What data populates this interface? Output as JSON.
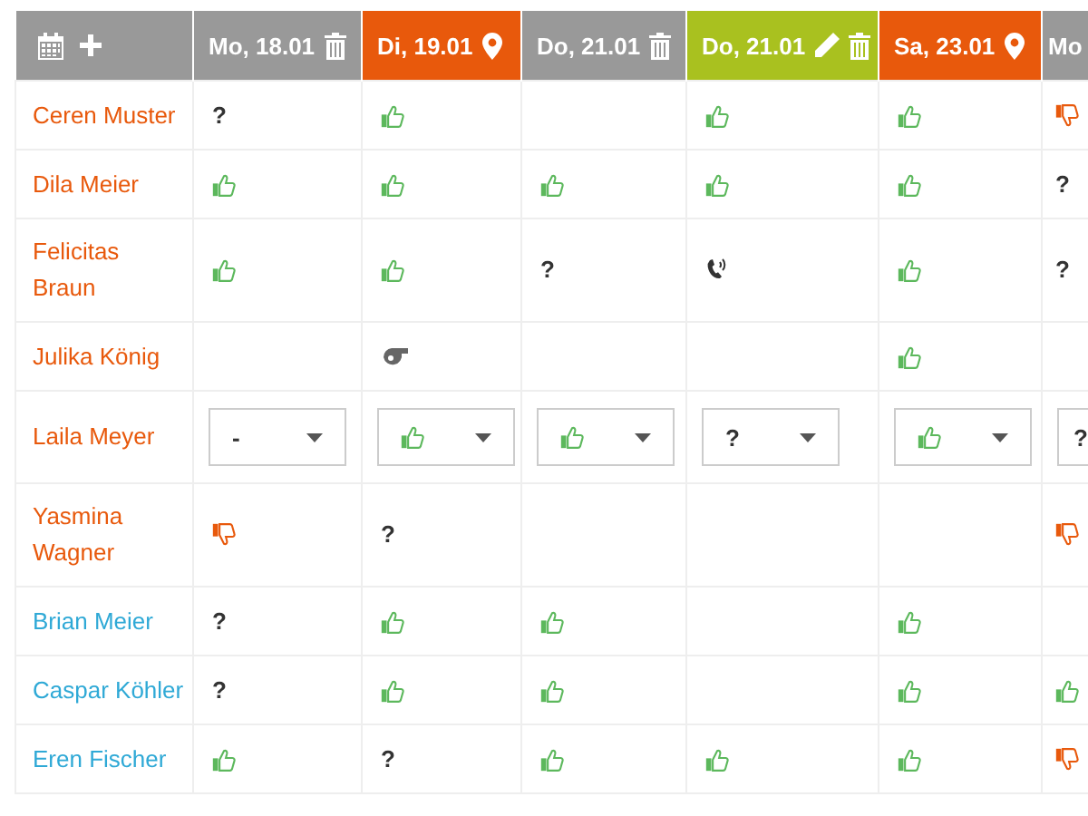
{
  "columns": [
    {
      "label": "Mo, 18.01",
      "color": "#999999",
      "editable": false,
      "deletable": true,
      "location": false
    },
    {
      "label": "Di, 19.01",
      "color": "#e8590c",
      "editable": false,
      "deletable": false,
      "location": true
    },
    {
      "label": "Do, 21.01",
      "color": "#999999",
      "editable": false,
      "deletable": true,
      "location": false
    },
    {
      "label": "Do, 21.01",
      "color": "#a9c11f",
      "editable": true,
      "deletable": true,
      "location": false
    },
    {
      "label": "Sa, 23.01",
      "color": "#e8590c",
      "editable": false,
      "deletable": false,
      "location": true
    },
    {
      "label": "Mo",
      "color": "#999999"
    }
  ],
  "rows": [
    {
      "name": "Ceren Muster",
      "color": "#e8590c",
      "cells": [
        {
          "kind": "maybe",
          "text": "?"
        },
        {
          "kind": "yes"
        },
        {
          "kind": "empty"
        },
        {
          "kind": "yes"
        },
        {
          "kind": "yes"
        },
        {
          "kind": "no"
        }
      ]
    },
    {
      "name": "Dila Meier",
      "color": "#e8590c",
      "cells": [
        {
          "kind": "yes"
        },
        {
          "kind": "yes"
        },
        {
          "kind": "yes"
        },
        {
          "kind": "yes"
        },
        {
          "kind": "yes"
        },
        {
          "kind": "maybe",
          "text": "?"
        }
      ]
    },
    {
      "name": "Felicitas Braun",
      "color": "#e8590c",
      "cells": [
        {
          "kind": "yes"
        },
        {
          "kind": "yes"
        },
        {
          "kind": "maybe",
          "text": "?"
        },
        {
          "kind": "phone"
        },
        {
          "kind": "yes"
        },
        {
          "kind": "maybe",
          "text": "?"
        }
      ]
    },
    {
      "name": "Julika König",
      "color": "#e8590c",
      "cells": [
        {
          "kind": "empty"
        },
        {
          "kind": "whistle"
        },
        {
          "kind": "empty"
        },
        {
          "kind": "empty"
        },
        {
          "kind": "yes"
        },
        {
          "kind": "empty"
        }
      ]
    },
    {
      "name": "Laila Meyer",
      "color": "#e8590c",
      "cells": [
        {
          "kind": "select",
          "text": "-"
        },
        {
          "kind": "select-yes"
        },
        {
          "kind": "select-yes"
        },
        {
          "kind": "select",
          "text": "?"
        },
        {
          "kind": "select-yes"
        },
        {
          "kind": "select",
          "text": "?"
        }
      ]
    },
    {
      "name": "Yasmina Wagner",
      "color": "#e8590c",
      "cells": [
        {
          "kind": "no"
        },
        {
          "kind": "maybe",
          "text": "?"
        },
        {
          "kind": "empty"
        },
        {
          "kind": "empty"
        },
        {
          "kind": "empty"
        },
        {
          "kind": "no"
        }
      ]
    },
    {
      "name": "Brian Meier",
      "color": "#2fa9d6",
      "cells": [
        {
          "kind": "maybe",
          "text": "?"
        },
        {
          "kind": "yes"
        },
        {
          "kind": "yes"
        },
        {
          "kind": "empty"
        },
        {
          "kind": "yes"
        },
        {
          "kind": "empty"
        }
      ]
    },
    {
      "name": "Caspar Köhler",
      "color": "#2fa9d6",
      "cells": [
        {
          "kind": "maybe",
          "text": "?"
        },
        {
          "kind": "yes"
        },
        {
          "kind": "yes"
        },
        {
          "kind": "empty"
        },
        {
          "kind": "yes"
        },
        {
          "kind": "yes"
        }
      ]
    },
    {
      "name": "Eren Fischer",
      "color": "#2fa9d6",
      "cells": [
        {
          "kind": "yes"
        },
        {
          "kind": "maybe",
          "text": "?"
        },
        {
          "kind": "yes"
        },
        {
          "kind": "yes"
        },
        {
          "kind": "yes"
        },
        {
          "kind": "no"
        }
      ]
    }
  ]
}
